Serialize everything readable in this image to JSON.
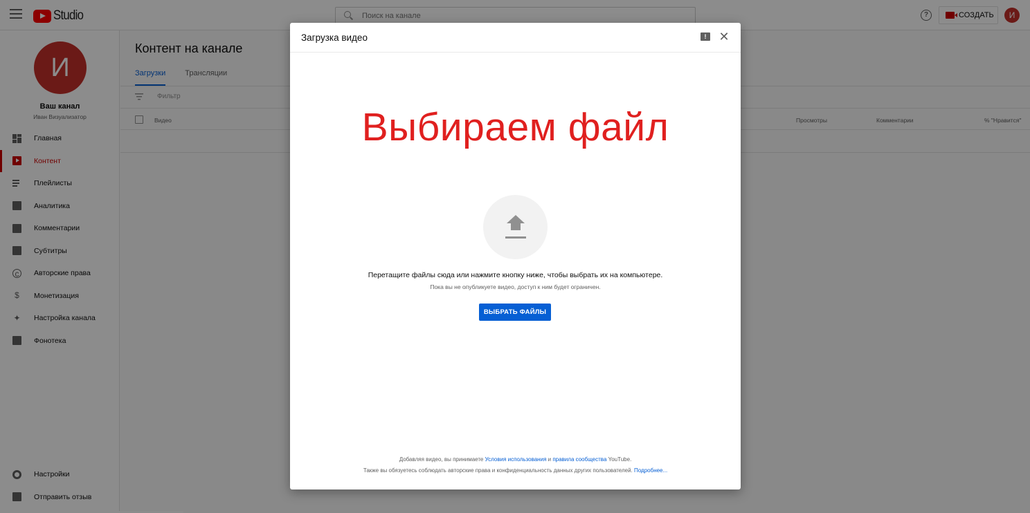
{
  "topbar": {
    "logo_text": "Studio",
    "search_placeholder": "Поиск на канале",
    "create_label": "СОЗДАТЬ",
    "avatar_letter": "И"
  },
  "sidebar": {
    "avatar_letter": "И",
    "channel_name": "Ваш канал",
    "channel_owner": "Иван Визуализатор",
    "items": [
      {
        "label": "Главная",
        "icon": "dashboard-icon"
      },
      {
        "label": "Контент",
        "icon": "content-icon",
        "active": true
      },
      {
        "label": "Плейлисты",
        "icon": "playlists-icon"
      },
      {
        "label": "Аналитика",
        "icon": "analytics-icon"
      },
      {
        "label": "Комментарии",
        "icon": "comments-icon"
      },
      {
        "label": "Субтитры",
        "icon": "subtitles-icon"
      },
      {
        "label": "Авторские права",
        "icon": "copyright-icon"
      },
      {
        "label": "Монетизация",
        "icon": "dollar-icon"
      },
      {
        "label": "Настройка канала",
        "icon": "magic-wand-icon"
      },
      {
        "label": "Фонотека",
        "icon": "audio-library-icon"
      }
    ],
    "bottom_items": [
      {
        "label": "Настройки",
        "icon": "gear-icon"
      },
      {
        "label": "Отправить отзыв",
        "icon": "feedback-icon"
      }
    ]
  },
  "main": {
    "title": "Контент на канале",
    "tabs": [
      "Загрузки",
      "Трансляции"
    ],
    "filter_placeholder": "Фильтр",
    "columns": [
      "Видео",
      "Просмотры",
      "Комментарии",
      "% \"Нравится\""
    ]
  },
  "dialog": {
    "title": "Загрузка видео",
    "annotation": "Выбираем файл",
    "drop_text": "Перетащите файлы сюда или нажмите кнопку ниже, чтобы выбрать их на компьютере.",
    "drop_sub": "Пока вы не опубликуете видео, доступ к ним будет ограничен.",
    "select_button": "ВЫБРАТЬ ФАЙЛЫ",
    "terms": {
      "line1_prefix": "Добавляя видео, вы принимаете ",
      "terms_link": "Условия использования",
      "and": " и ",
      "community_link": "правила сообщества",
      "line1_suffix": " YouTube.",
      "line2_prefix": "Также вы обязуетесь соблюдать авторские права и конфиденциальность данных других пользователей. ",
      "more_link": "Подробнее..."
    }
  },
  "colors": {
    "brand_red": "#ff0000",
    "accent_blue": "#065fd4",
    "annotation_red": "#e0201f"
  }
}
